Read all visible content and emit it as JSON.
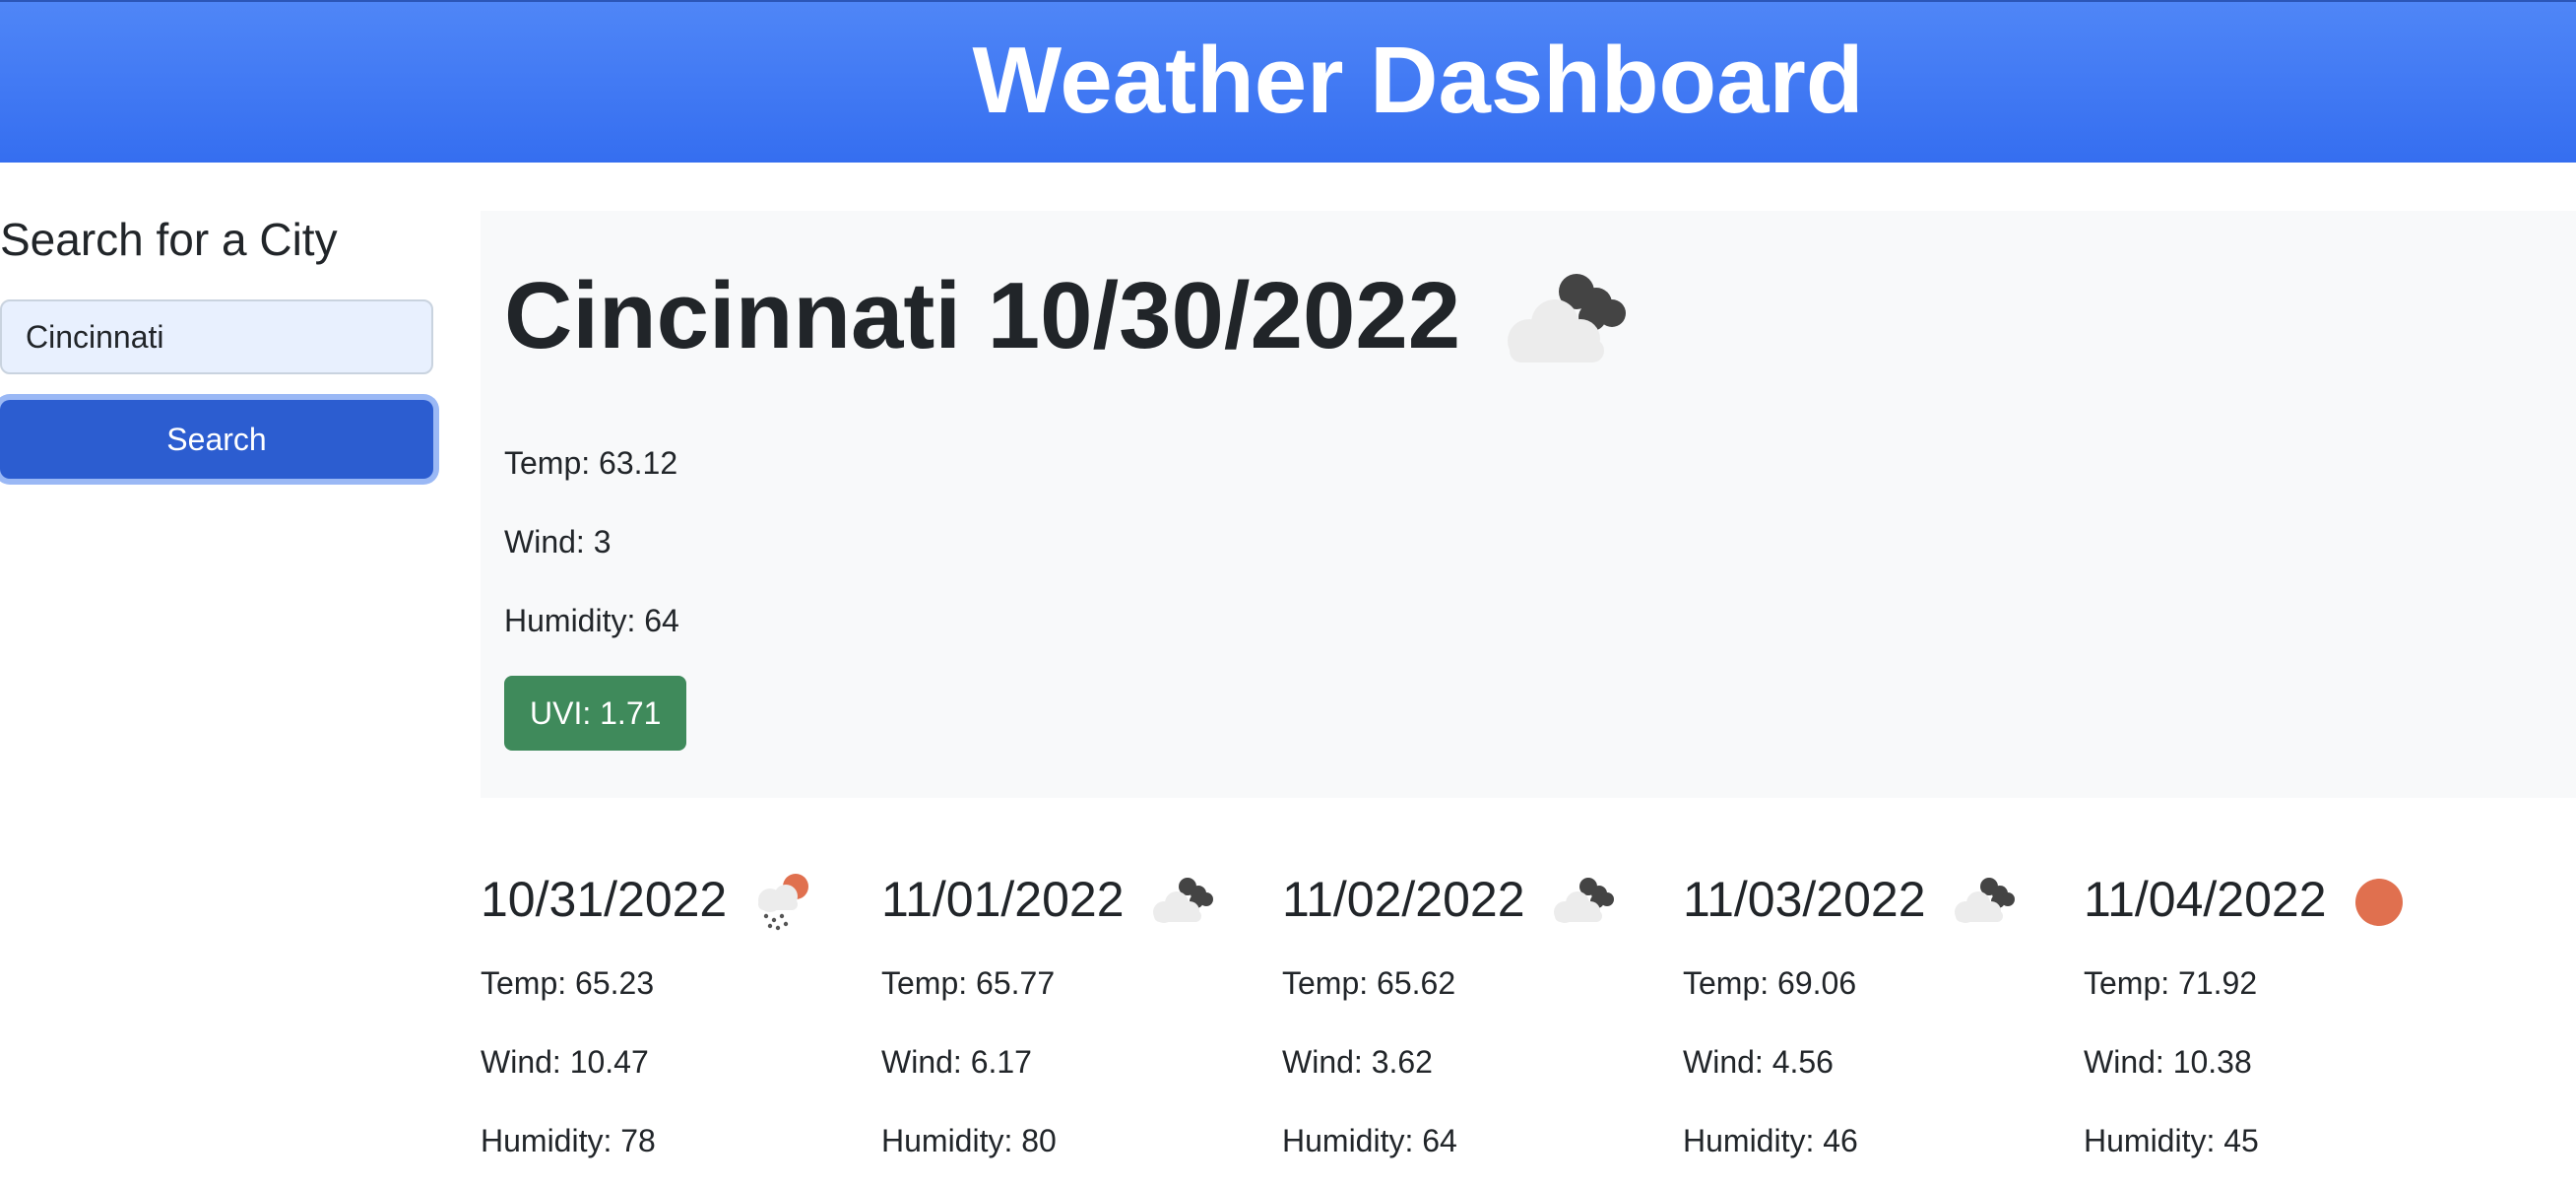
{
  "header": {
    "title": "Weather Dashboard"
  },
  "sidebar": {
    "title": "Search for a City",
    "search_value": "Cincinnati",
    "search_button_label": "Search"
  },
  "current": {
    "title": "Cincinnati 10/30/2022",
    "icon": "broken-clouds-icon",
    "temp": "Temp: 63.12",
    "wind": "Wind: 3",
    "humidity": "Humidity: 64",
    "uvi": "UVI: 1.71",
    "uvi_color": "#3f8a5b"
  },
  "forecast": [
    {
      "date": "10/31/2022",
      "icon": "sun-snow-icon",
      "temp": "Temp: 65.23",
      "wind": "Wind: 10.47",
      "humidity": "Humidity: 78"
    },
    {
      "date": "11/01/2022",
      "icon": "broken-clouds-icon",
      "temp": "Temp: 65.77",
      "wind": "Wind: 6.17",
      "humidity": "Humidity: 80"
    },
    {
      "date": "11/02/2022",
      "icon": "broken-clouds-icon",
      "temp": "Temp: 65.62",
      "wind": "Wind: 3.62",
      "humidity": "Humidity: 64"
    },
    {
      "date": "11/03/2022",
      "icon": "broken-clouds-icon",
      "temp": "Temp: 69.06",
      "wind": "Wind: 4.56",
      "humidity": "Humidity: 46"
    },
    {
      "date": "11/04/2022",
      "icon": "clear-sun-icon",
      "temp": "Temp: 71.92",
      "wind": "Wind: 10.38",
      "humidity": "Humidity: 45"
    }
  ],
  "colors": {
    "header": "#356ef0",
    "button": "#2c5dd0",
    "panel": "#f8f9fa",
    "sun": "#e0704f"
  }
}
